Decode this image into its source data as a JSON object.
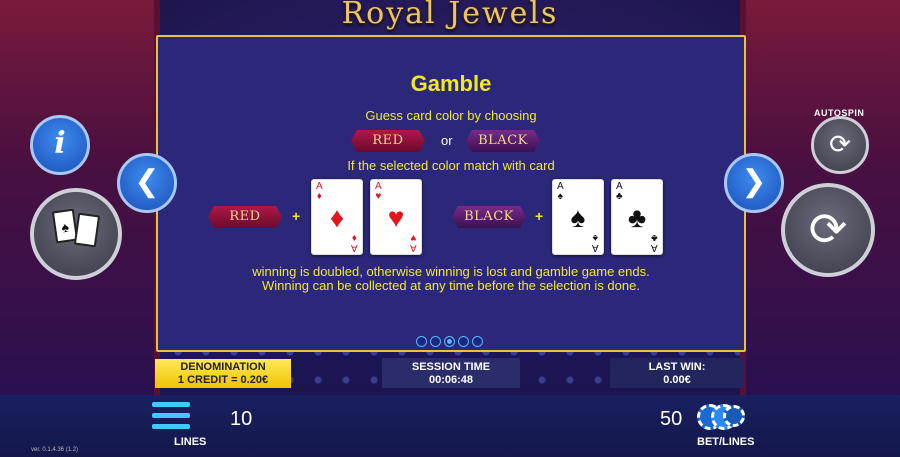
{
  "game": {
    "title": "Royal Jewels",
    "version": "ver. 0.1.4.36 (1.2)"
  },
  "help_panel": {
    "heading": "Gamble",
    "instruction": "Guess card color by choosing",
    "red_label": "RED",
    "or_label": "or",
    "black_label": "BLACK",
    "condition": "If the selected color match with card",
    "red_cards": [
      {
        "rank": "A",
        "suit": "♦"
      },
      {
        "rank": "A",
        "suit": "♥"
      }
    ],
    "black_cards": [
      {
        "rank": "A",
        "suit": "♠"
      },
      {
        "rank": "A",
        "suit": "♣"
      }
    ],
    "plus": "+",
    "result_line1": "winning is doubled, otherwise winning is lost and gamble game ends.",
    "result_line2": "Winning can be collected at any time before the selection is done.",
    "pages_total": 5,
    "page_current": 3
  },
  "controls": {
    "autospin_label": "AUTOSPIN",
    "info_glyph": "i",
    "prev_glyph": "❮",
    "next_glyph": "❯",
    "spin_glyph": "⟳",
    "autospin_glyph": "⟳"
  },
  "info_bar": {
    "denomination_label": "DENOMINATION",
    "denomination_value": "1 CREDIT = 0.20€",
    "session_label": "SESSION TIME",
    "session_value": "00:06:48",
    "last_win_label": "LAST WIN:",
    "last_win_value": "0.00€"
  },
  "bottom_bar": {
    "lines_value": "10",
    "lines_label": "LINES",
    "bet_value": "50",
    "bet_label": "BET/LINES"
  },
  "colors": {
    "panel_border": "#e7c23a",
    "text_yellow": "#f1ea23",
    "button_blue": "#1a4fb8"
  }
}
